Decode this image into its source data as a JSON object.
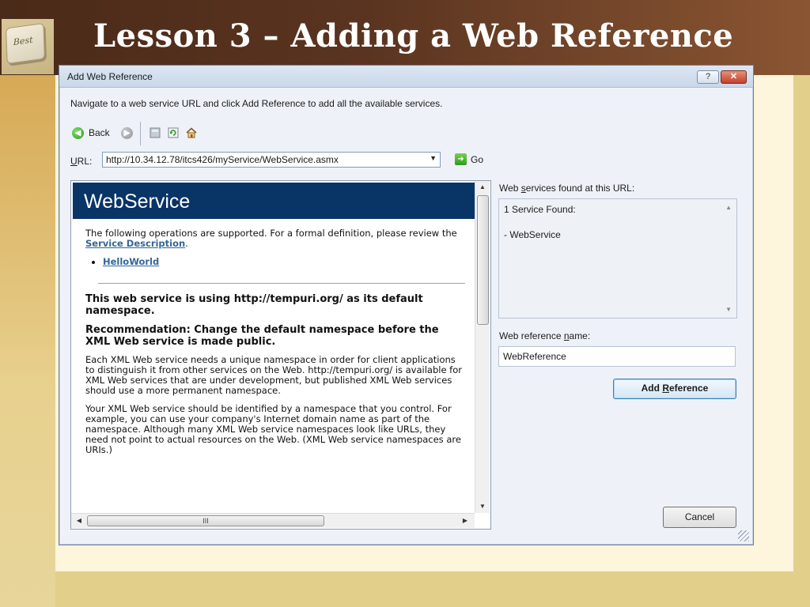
{
  "slide": {
    "title": "Lesson 3 – Adding a Web Reference",
    "logo_text": "Best"
  },
  "dialog": {
    "title": "Add Web Reference",
    "help_symbol": "?",
    "close_symbol": "✕",
    "instruction": "Navigate to a web service URL and click Add Reference to add all the available services.",
    "toolbar": {
      "back_label": "Back"
    },
    "url": {
      "label_prefix": "U",
      "label_rest": "RL:",
      "value": "http://10.34.12.78/itcs426/myService/WebService.asmx"
    },
    "go_label": "Go",
    "browser": {
      "header_title": "WebService",
      "intro_text": "The following operations are supported. For a formal definition, please review the",
      "service_description_link": "Service Description",
      "period": ".",
      "operations": [
        "HelloWorld"
      ],
      "namespace_heading": "This web service is using http://tempuri.org/ as its default namespace.",
      "recommendation_heading": "Recommendation: Change the default namespace before the XML Web service is made public.",
      "para1": "Each XML Web service needs a unique namespace in order for client applications to distinguish it from other services on the Web. http://tempuri.org/ is available for XML Web services that are under development, but published XML Web services should use a more permanent namespace.",
      "para2": "Your XML Web service should be identified by a namespace that you control. For example, you can use your company's Internet domain name as part of the namespace. Although many XML Web service namespaces look like URLs, they need not point to actual resources on the Web. (XML Web service namespaces are URIs.)",
      "hscroll_grip": "III"
    },
    "found": {
      "label_pre": "Web ",
      "label_mnemonic": "s",
      "label_post": "ervices found at this URL:",
      "count_text": "1 Service Found:",
      "service_item": "- WebService"
    },
    "reference_name": {
      "label_pre": "Web reference ",
      "label_mnemonic": "n",
      "label_post": "ame:",
      "value": "WebReference"
    },
    "add_reference": {
      "label_pre": "Add ",
      "label_mnemonic": "R",
      "label_post": "eference"
    },
    "cancel_label": "Cancel"
  },
  "colors": {
    "title_bar_brown": "#4a2a18",
    "webservice_header_navy": "#083466",
    "link_blue": "#336699",
    "cream_background": "#fdf5dc"
  }
}
